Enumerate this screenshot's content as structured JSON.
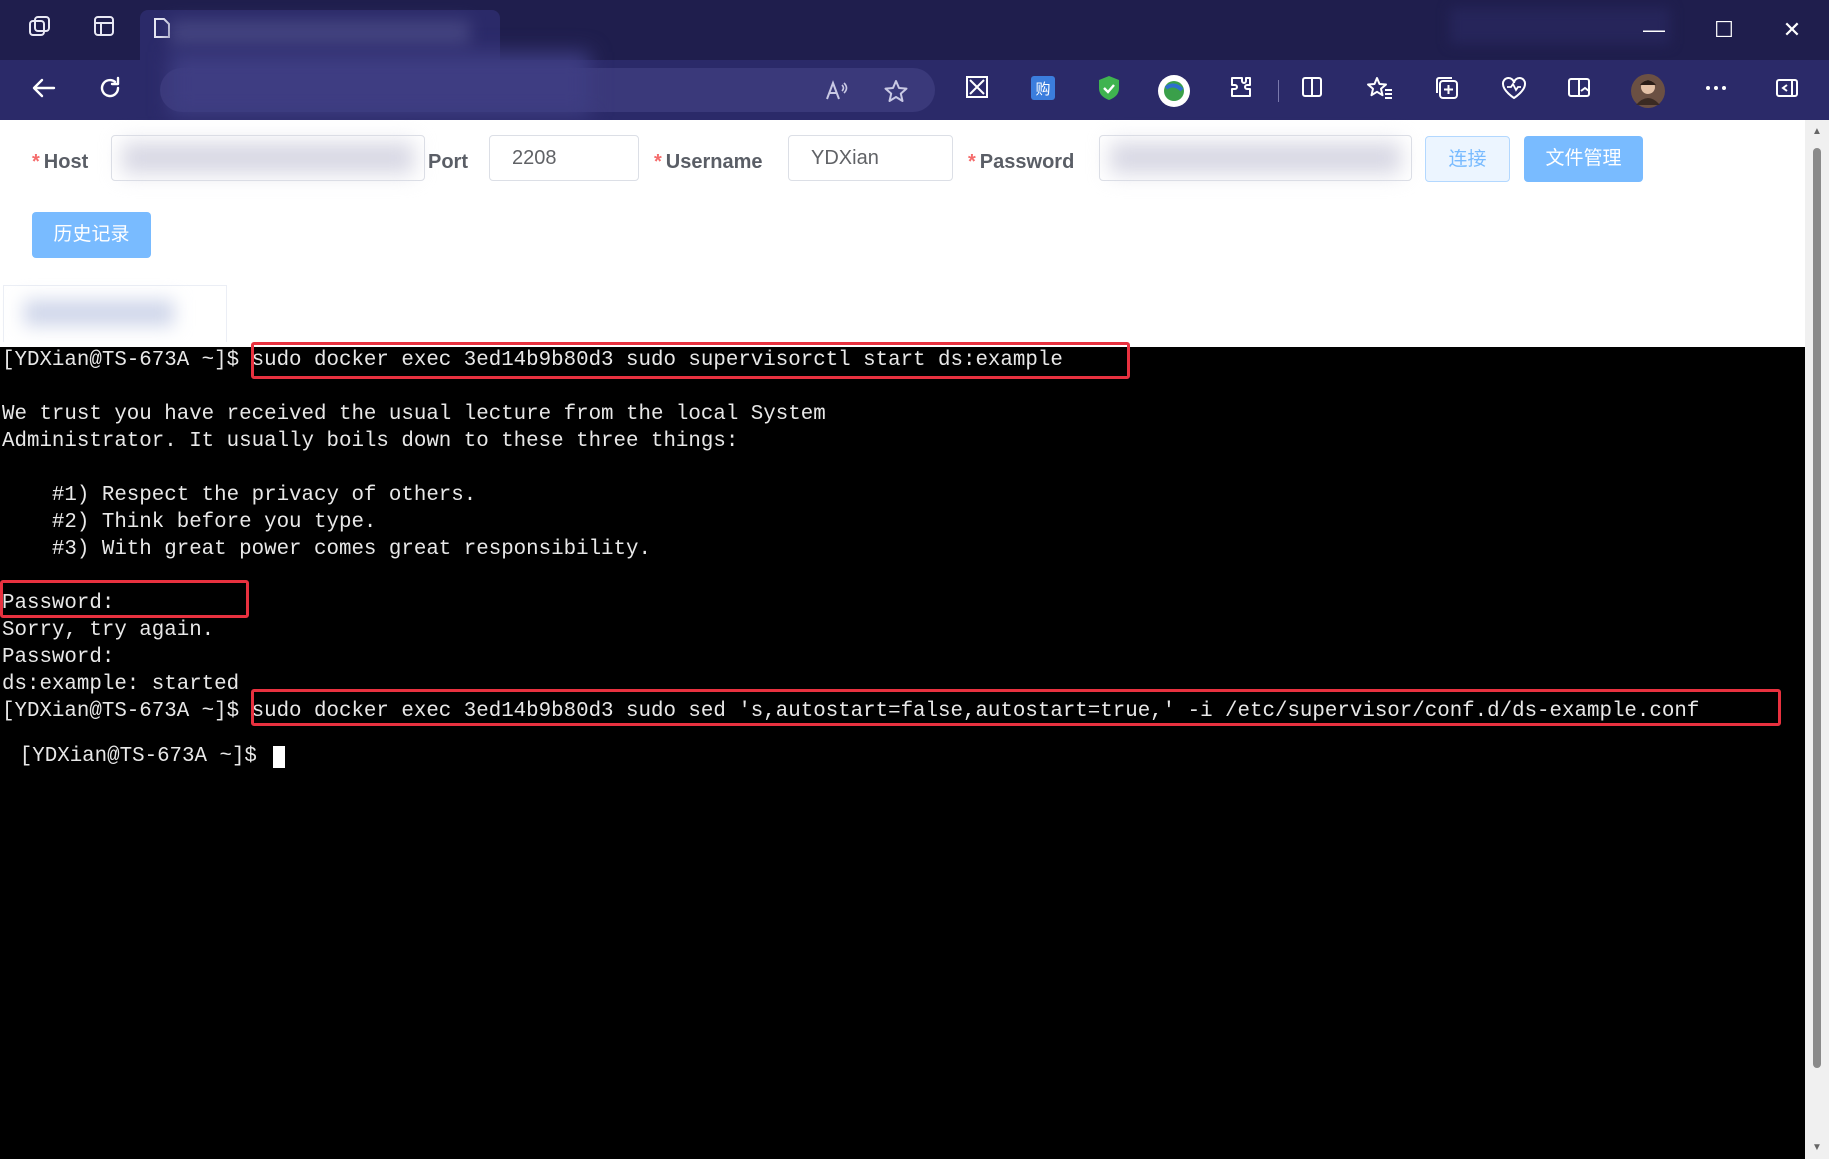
{
  "browser": {
    "tab_icon_workspaces": "workspaces-icon",
    "tab_icon_tabs": "tab-actions-icon",
    "window_controls": {
      "minimize": "—",
      "maximize": "☐",
      "close": "✕"
    }
  },
  "form": {
    "host_label": "Host",
    "port_label": "Port",
    "port_value": "2208",
    "username_label": "Username",
    "username_value": "YDXian",
    "password_label": "Password",
    "required_mark": "*",
    "connect_button": "连接",
    "file_manager_button": "文件管理",
    "history_button": "历史记录"
  },
  "terminal": {
    "prompt": "[YDXian@TS-673A ~]$",
    "lines": [
      "[YDXian@TS-673A ~]$ sudo docker exec 3ed14b9b80d3 sudo supervisorctl start ds:example",
      "",
      "We trust you have received the usual lecture from the local System",
      "Administrator. It usually boils down to these three things:",
      "",
      "    #1) Respect the privacy of others.",
      "    #2) Think before you type.",
      "    #3) With great power comes great responsibility.",
      "",
      "Password:",
      "Sorry, try again.",
      "Password:",
      "ds:example: started",
      "[YDXian@TS-673A ~]$ sudo docker exec 3ed14b9b80d3 sudo sed 's,autostart=false,autostart=true,' -i /etc/supervisor/conf.d/ds-example.conf",
      "[YDXian@TS-673A ~]$ "
    ]
  },
  "colors": {
    "titlebar": "#1f1e4d",
    "toolbar": "#2b2a69",
    "primary_button": "#79bbff",
    "highlight_box": "#e8313f",
    "terminal_bg": "#000000"
  }
}
